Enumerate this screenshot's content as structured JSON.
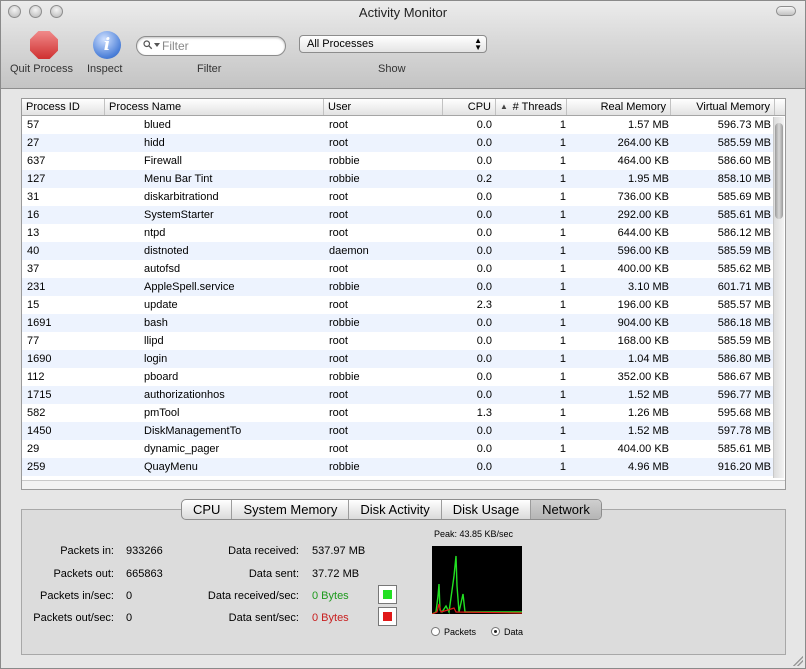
{
  "window": {
    "title": "Activity Monitor"
  },
  "toolbar": {
    "quit_label": "Quit Process",
    "inspect_label": "Inspect",
    "filter": {
      "placeholder": "Filter",
      "value": "",
      "label": "Filter"
    },
    "show": {
      "selected": "All Processes",
      "label": "Show"
    }
  },
  "table": {
    "columns": {
      "pid": "Process ID",
      "name": "Process Name",
      "user": "User",
      "cpu": "CPU",
      "threads": "# Threads",
      "real": "Real Memory",
      "virtual": "Virtual Memory"
    },
    "sort_indicator": "▲",
    "rows": [
      {
        "pid": "57",
        "name": "blued",
        "user": "root",
        "cpu": "0.0",
        "threads": "1",
        "real": "1.57 MB",
        "virtual": "596.73 MB"
      },
      {
        "pid": "27",
        "name": "hidd",
        "user": "root",
        "cpu": "0.0",
        "threads": "1",
        "real": "264.00 KB",
        "virtual": "585.59 MB"
      },
      {
        "pid": "637",
        "name": "Firewall",
        "user": "robbie",
        "cpu": "0.0",
        "threads": "1",
        "real": "464.00 KB",
        "virtual": "586.60 MB"
      },
      {
        "pid": "127",
        "name": "Menu Bar Tint",
        "user": "robbie",
        "cpu": "0.2",
        "threads": "1",
        "real": "1.95 MB",
        "virtual": "858.10 MB"
      },
      {
        "pid": "31",
        "name": "diskarbitrationd",
        "user": "root",
        "cpu": "0.0",
        "threads": "1",
        "real": "736.00 KB",
        "virtual": "585.69 MB"
      },
      {
        "pid": "16",
        "name": "SystemStarter",
        "user": "root",
        "cpu": "0.0",
        "threads": "1",
        "real": "292.00 KB",
        "virtual": "585.61 MB"
      },
      {
        "pid": "13",
        "name": "ntpd",
        "user": "root",
        "cpu": "0.0",
        "threads": "1",
        "real": "644.00 KB",
        "virtual": "586.12 MB"
      },
      {
        "pid": "40",
        "name": "distnoted",
        "user": "daemon",
        "cpu": "0.0",
        "threads": "1",
        "real": "596.00 KB",
        "virtual": "585.59 MB"
      },
      {
        "pid": "37",
        "name": "autofsd",
        "user": "root",
        "cpu": "0.0",
        "threads": "1",
        "real": "400.00 KB",
        "virtual": "585.62 MB"
      },
      {
        "pid": "231",
        "name": "AppleSpell.service",
        "user": "robbie",
        "cpu": "0.0",
        "threads": "1",
        "real": "3.10 MB",
        "virtual": "601.71 MB"
      },
      {
        "pid": "15",
        "name": "update",
        "user": "root",
        "cpu": "2.3",
        "threads": "1",
        "real": "196.00 KB",
        "virtual": "585.57 MB"
      },
      {
        "pid": "1691",
        "name": "bash",
        "user": "robbie",
        "cpu": "0.0",
        "threads": "1",
        "real": "904.00 KB",
        "virtual": "586.18 MB"
      },
      {
        "pid": "77",
        "name": "llipd",
        "user": "root",
        "cpu": "0.0",
        "threads": "1",
        "real": "168.00 KB",
        "virtual": "585.59 MB"
      },
      {
        "pid": "1690",
        "name": "login",
        "user": "root",
        "cpu": "0.0",
        "threads": "1",
        "real": "1.04 MB",
        "virtual": "586.80 MB"
      },
      {
        "pid": "112",
        "name": "pboard",
        "user": "robbie",
        "cpu": "0.0",
        "threads": "1",
        "real": "352.00 KB",
        "virtual": "586.67 MB"
      },
      {
        "pid": "1715",
        "name": "authorizationhos",
        "user": "root",
        "cpu": "0.0",
        "threads": "1",
        "real": "1.52 MB",
        "virtual": "596.77 MB"
      },
      {
        "pid": "582",
        "name": "pmTool",
        "user": "root",
        "cpu": "1.3",
        "threads": "1",
        "real": "1.26 MB",
        "virtual": "595.68 MB"
      },
      {
        "pid": "1450",
        "name": "DiskManagementTo",
        "user": "root",
        "cpu": "0.0",
        "threads": "1",
        "real": "1.52 MB",
        "virtual": "597.78 MB"
      },
      {
        "pid": "29",
        "name": "dynamic_pager",
        "user": "root",
        "cpu": "0.0",
        "threads": "1",
        "real": "404.00 KB",
        "virtual": "585.61 MB"
      },
      {
        "pid": "259",
        "name": "QuayMenu",
        "user": "robbie",
        "cpu": "0.0",
        "threads": "1",
        "real": "4.96 MB",
        "virtual": "916.20 MB"
      }
    ]
  },
  "tabs": [
    {
      "label": "CPU",
      "active": false
    },
    {
      "label": "System Memory",
      "active": false
    },
    {
      "label": "Disk Activity",
      "active": false
    },
    {
      "label": "Disk Usage",
      "active": false
    },
    {
      "label": "Network",
      "active": true
    }
  ],
  "network": {
    "packets_in_label": "Packets in:",
    "packets_in": "933266",
    "packets_out_label": "Packets out:",
    "packets_out": "665863",
    "packets_in_sec_label": "Packets in/sec:",
    "packets_in_sec": "0",
    "packets_out_sec_label": "Packets out/sec:",
    "packets_out_sec": "0",
    "data_received_label": "Data received:",
    "data_received": "537.97 MB",
    "data_sent_label": "Data sent:",
    "data_sent": "37.72 MB",
    "data_received_sec_label": "Data received/sec:",
    "data_received_sec": "0 Bytes",
    "data_sent_sec_label": "Data sent/sec:",
    "data_sent_sec": "0 Bytes",
    "received_color": "#22e022",
    "sent_color": "#e01818",
    "peak": "Peak: 43.85 KB/sec",
    "graph_mode_options": [
      "Packets",
      "Data"
    ],
    "graph_mode_selected": "Data"
  },
  "icons": {
    "quit": "stop-octagon-icon",
    "inspect": "info-icon",
    "search": "magnifier-icon",
    "popup": "up-down-arrows-icon"
  },
  "colors": {
    "row_stripe": "#edf3fe",
    "graph_background": "#000000"
  }
}
